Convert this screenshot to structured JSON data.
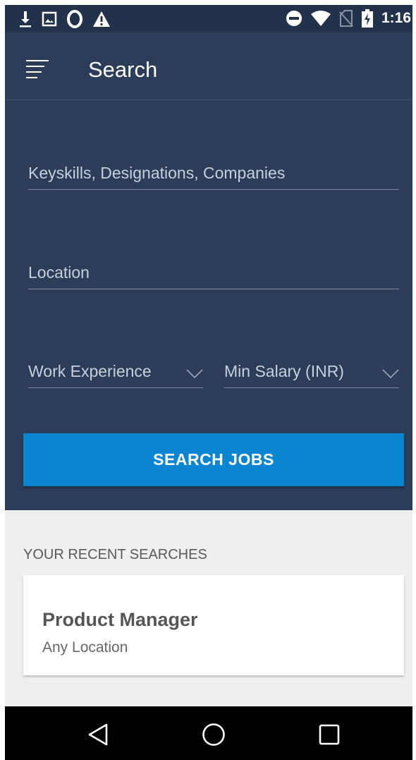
{
  "status_bar": {
    "time": "1:16",
    "left_icons": [
      "download-icon",
      "image-icon",
      "opera-icon",
      "warning-icon"
    ],
    "right_icons": [
      "do-not-disturb-icon",
      "wifi-icon",
      "no-sim-icon",
      "battery-charging-icon"
    ]
  },
  "toolbar": {
    "title": "Search",
    "menu_icon": "menu-icon"
  },
  "form": {
    "keyskills_placeholder": "Keyskills, Designations, Companies",
    "location_placeholder": "Location",
    "experience_label": "Work Experience",
    "salary_label": "Min Salary (INR)",
    "search_button": "SEARCH JOBS"
  },
  "recent": {
    "heading": "YOUR RECENT SEARCHES",
    "items": [
      {
        "title": "Product Manager",
        "subtitle": "Any Location"
      }
    ]
  },
  "nav": {
    "icons": [
      "back-icon",
      "home-icon",
      "recents-icon"
    ]
  },
  "colors": {
    "background": "#2b3d58",
    "status_bar": "#22324b",
    "accent": "#0a85d2",
    "recent_bg": "#efefef"
  }
}
